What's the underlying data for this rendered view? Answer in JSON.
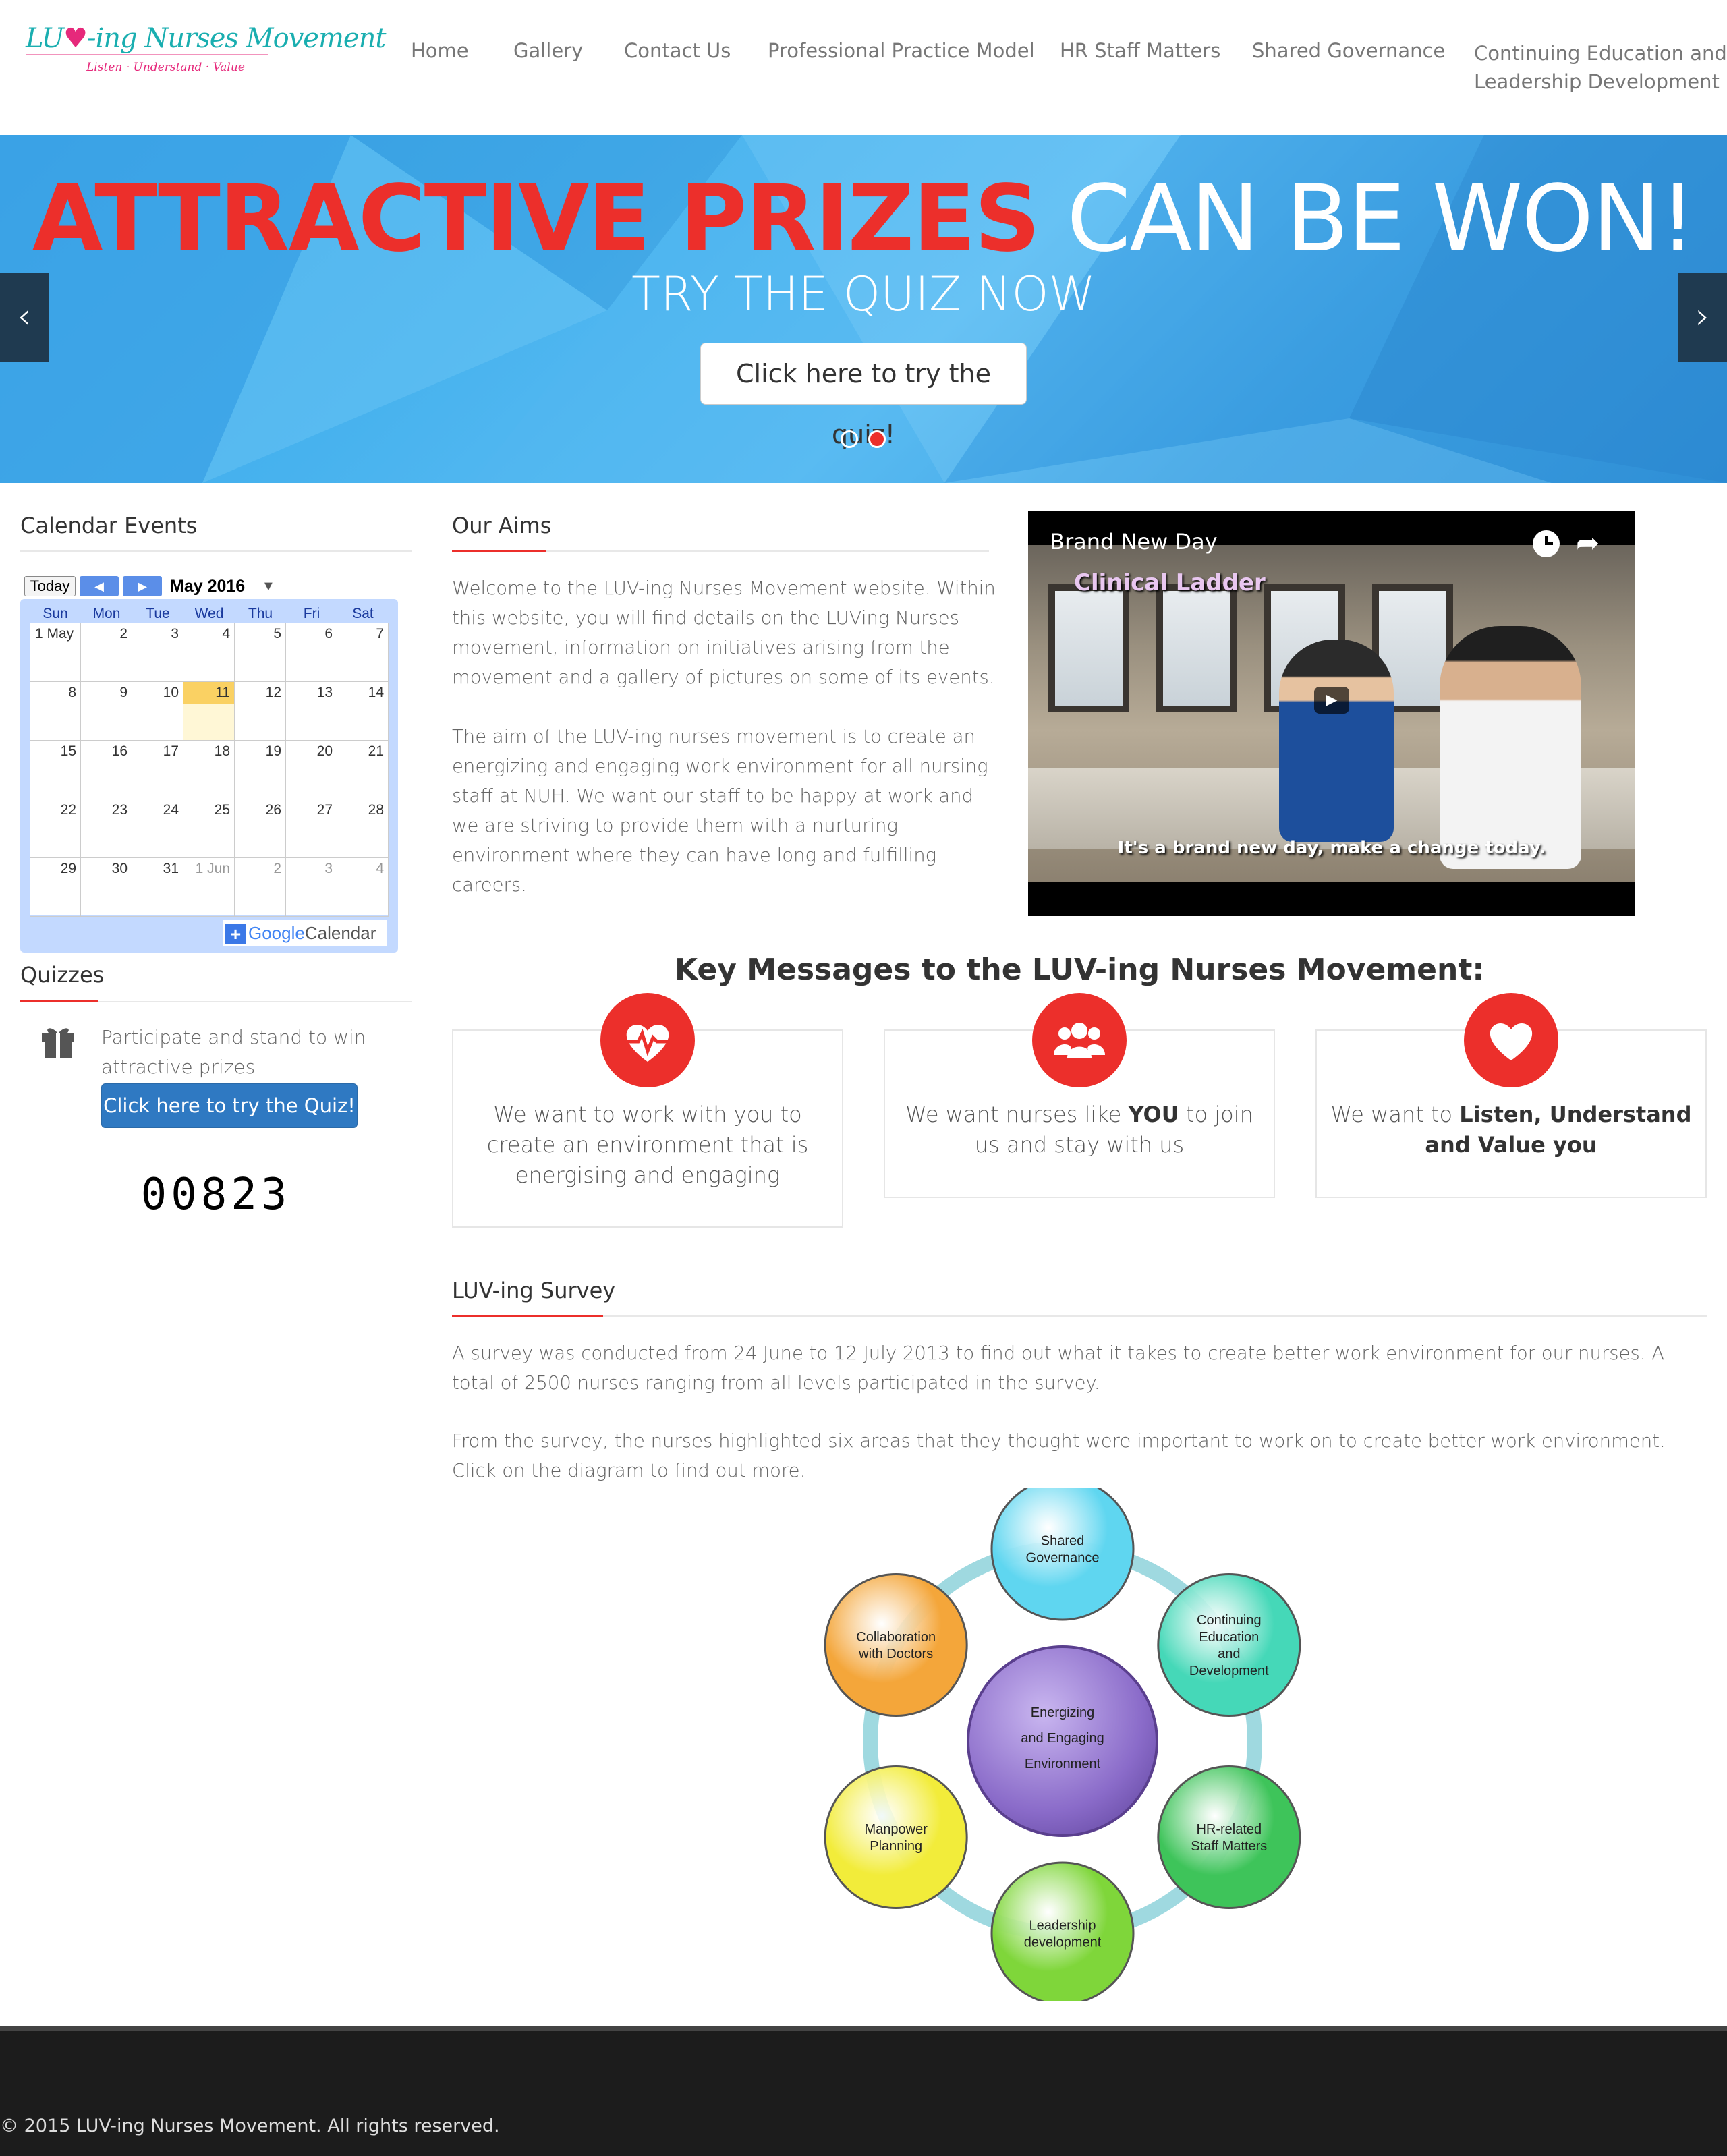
{
  "nav": {
    "logo_main_a": "LU",
    "logo_main_b": "-ing Nurses Movement",
    "logo_tagline": "Listen · Understand · Value",
    "items": [
      "Home",
      "Gallery",
      "Contact Us",
      "Professional Practice Model",
      "HR Staff Matters",
      "Shared Governance"
    ],
    "last_item_line1": "Continuing Education and",
    "last_item_line2": "Leadership Development"
  },
  "hero": {
    "title_red": "ATTRACTIVE PRIZES",
    "title_white": "CAN BE WON!",
    "subtitle": "TRY THE QUIZ NOW",
    "button": "Click here to try the quiz!",
    "prev_icon": "chevron-left-icon",
    "next_icon": "chevron-right-icon",
    "slides": 2,
    "active_slide": 2,
    "active_dot_color": "#ec2f2b"
  },
  "sidebar": {
    "calendar_heading": "Calendar Events",
    "calendar": {
      "today_label": "Today",
      "month_label": "May 2016",
      "days_of_week": [
        "Sun",
        "Mon",
        "Tue",
        "Wed",
        "Thu",
        "Fri",
        "Sat"
      ],
      "weeks": [
        [
          "1 May",
          "2",
          "3",
          "4",
          "5",
          "6",
          "7"
        ],
        [
          "8",
          "9",
          "10",
          "11",
          "12",
          "13",
          "14"
        ],
        [
          "15",
          "16",
          "17",
          "18",
          "19",
          "20",
          "21"
        ],
        [
          "22",
          "23",
          "24",
          "25",
          "26",
          "27",
          "28"
        ],
        [
          "29",
          "30",
          "31",
          "1 Jun",
          "2",
          "3",
          "4"
        ]
      ],
      "today_date": "11",
      "footer_google": "Google",
      "footer_calendar": "Calendar"
    },
    "quizzes_heading": "Quizzes",
    "quiz_text": "Participate and stand to win attractive prizes",
    "quiz_button": "Click here to try the Quiz!",
    "counter": "00823",
    "gift_icon": "gift-icon"
  },
  "aims": {
    "heading": "Our Aims",
    "p1": "Welcome to the LUV-ing Nurses Movement website. Within this website, you will find details on the LUVing Nurses movement, information on initiatives arising from the movement and a gallery of pictures on some of its events.",
    "p2": "The aim of the LUV-ing nurses movement is to create an energizing and engaging work environment for all nursing staff at NUH. We want our staff to be happy at work and we are striving to provide them with a nurturing environment where they can have long and fulfilling careers."
  },
  "video": {
    "title": "Brand New Day",
    "overlay": "Clinical Ladder",
    "caption": "It's a brand new day, make a change today."
  },
  "key_messages": {
    "title": "Key Messages to the LUV-ing Nurses Movement:",
    "items": [
      {
        "icon": "heartbeat-icon",
        "text": "We want to work with you to create an environment that is energising and engaging"
      },
      {
        "icon": "users-icon",
        "pre": "We want nurses like ",
        "bold": "YOU",
        "post": " to join us and stay with us"
      },
      {
        "icon": "heart-icon",
        "pre": "We want to ",
        "bold": "Listen, Understand and Value you"
      }
    ]
  },
  "survey": {
    "heading": "LUV-ing Survey",
    "p1": "A survey was conducted from 24 June to 12 July 2013 to find out what it takes to create better work environment for our nurses. A total of 2500 nurses ranging from all levels participated in the survey.",
    "p2": "From the survey, the nurses highlighted six areas that they thought were important to work on to create better work environment. Click on the diagram to find out more.",
    "diagram": {
      "center": [
        "Energizing",
        "and Engaging",
        "Environment"
      ],
      "nodes": [
        {
          "lines": [
            "Shared",
            "Governance"
          ],
          "color": "#5fd6f0"
        },
        {
          "lines": [
            "Continuing",
            "Education",
            "and",
            "Development"
          ],
          "color": "#45d8b8"
        },
        {
          "lines": [
            "HR-related",
            "Staff Matters"
          ],
          "color": "#3ec45a"
        },
        {
          "lines": [
            "Leadership",
            "development"
          ],
          "color": "#7fd63a"
        },
        {
          "lines": [
            "Manpower",
            "Planning"
          ],
          "color": "#f2ec3a"
        },
        {
          "lines": [
            "Collaboration",
            "with Doctors"
          ],
          "color": "#f4a63a"
        }
      ]
    }
  },
  "footer": {
    "copyright": "© 2015 LUV-ing Nurses Movement. All rights reserved."
  }
}
